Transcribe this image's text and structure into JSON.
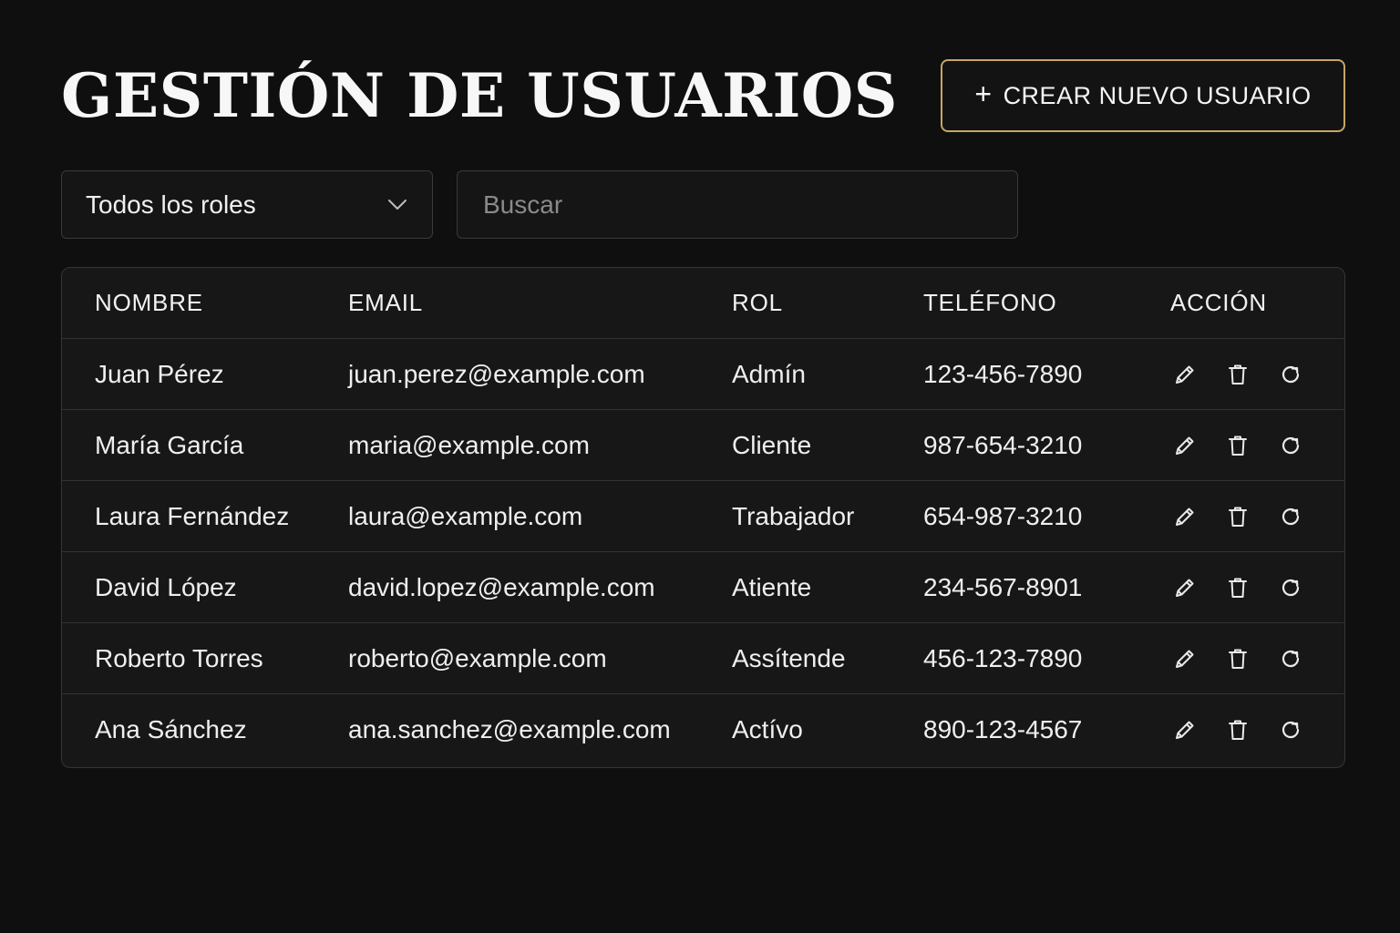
{
  "header": {
    "title": "GESTIÓN DE USUARIOS",
    "create_button": {
      "icon": "plus-icon",
      "label": "CREAR NUEVO USUARIO"
    }
  },
  "filters": {
    "role_select": {
      "value": "Todos los roles",
      "icon": "chevron-down-icon"
    },
    "search": {
      "placeholder": "Buscar",
      "value": ""
    }
  },
  "table": {
    "columns": [
      "NOMBRE",
      "EMAIL",
      "ROL",
      "TELÉFONO",
      "ACCIÓN"
    ],
    "rows": [
      {
        "name": "Juan Pérez",
        "email": "juan.perez@example.com",
        "role": "Admín",
        "phone": "123-456-7890"
      },
      {
        "name": "María García",
        "email": "maria@example.com",
        "role": "Cliente",
        "phone": "987-654-3210"
      },
      {
        "name": "Laura Fernández",
        "email": "laura@example.com",
        "role": "Trabajador",
        "phone": "654-987-3210"
      },
      {
        "name": "David López",
        "email": "david.lopez@example.com",
        "role": "Atiente",
        "phone": "234-567-8901"
      },
      {
        "name": "Roberto Torres",
        "email": "roberto@example.com",
        "role": "Assítende",
        "phone": "456-123-7890"
      },
      {
        "name": "Ana Sánchez",
        "email": "ana.sanchez@example.com",
        "role": "Actívo",
        "phone": "890-123-4567"
      }
    ],
    "action_icons": [
      "pencil-icon",
      "trash-icon",
      "refresh-icon"
    ]
  },
  "colors": {
    "background": "#0f0f0f",
    "accent_border": "#c8a46a",
    "text": "#f2f2f2",
    "placeholder": "#8a8a8a"
  }
}
